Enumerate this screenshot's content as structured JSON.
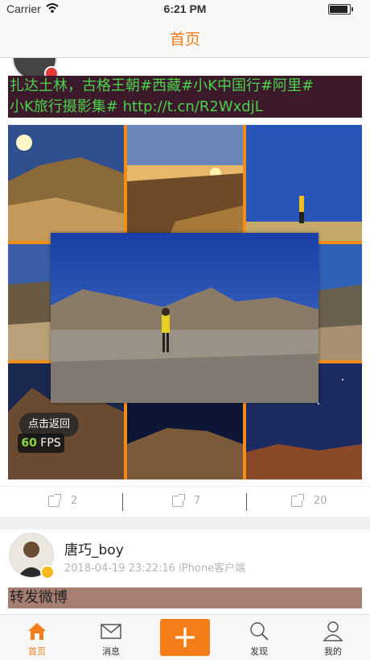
{
  "status_bar": {
    "carrier": "Carrier",
    "time": "6:21 PM"
  },
  "nav": {
    "title": "首页"
  },
  "post1": {
    "text_line1": "扎达土林，古格王朝#西藏#小K中国行#阿里#",
    "text_line2": "小K旅行摄影集# http://t.cn/R2WxdjL",
    "back_button": "点击返回",
    "fps_value": "60",
    "fps_unit": "FPS",
    "actions": [
      {
        "icon": "share-icon",
        "count": "2"
      },
      {
        "icon": "comment-icon",
        "count": "7"
      },
      {
        "icon": "like-icon",
        "count": "20"
      }
    ]
  },
  "post2": {
    "username": "唐巧_boy",
    "meta": "2018-04-19 23:22:16  iPhone客户端",
    "text": "转发微博"
  },
  "tabbar": {
    "items": [
      {
        "label": "首页",
        "icon": "home-icon"
      },
      {
        "label": "消息",
        "icon": "message-icon"
      },
      {
        "label": "+",
        "icon": "plus-icon"
      },
      {
        "label": "发现",
        "icon": "discover-icon"
      },
      {
        "label": "我的",
        "icon": "profile-icon"
      }
    ]
  },
  "colors": {
    "accent": "#f47d1a",
    "hashtag": "#4bd24b"
  }
}
